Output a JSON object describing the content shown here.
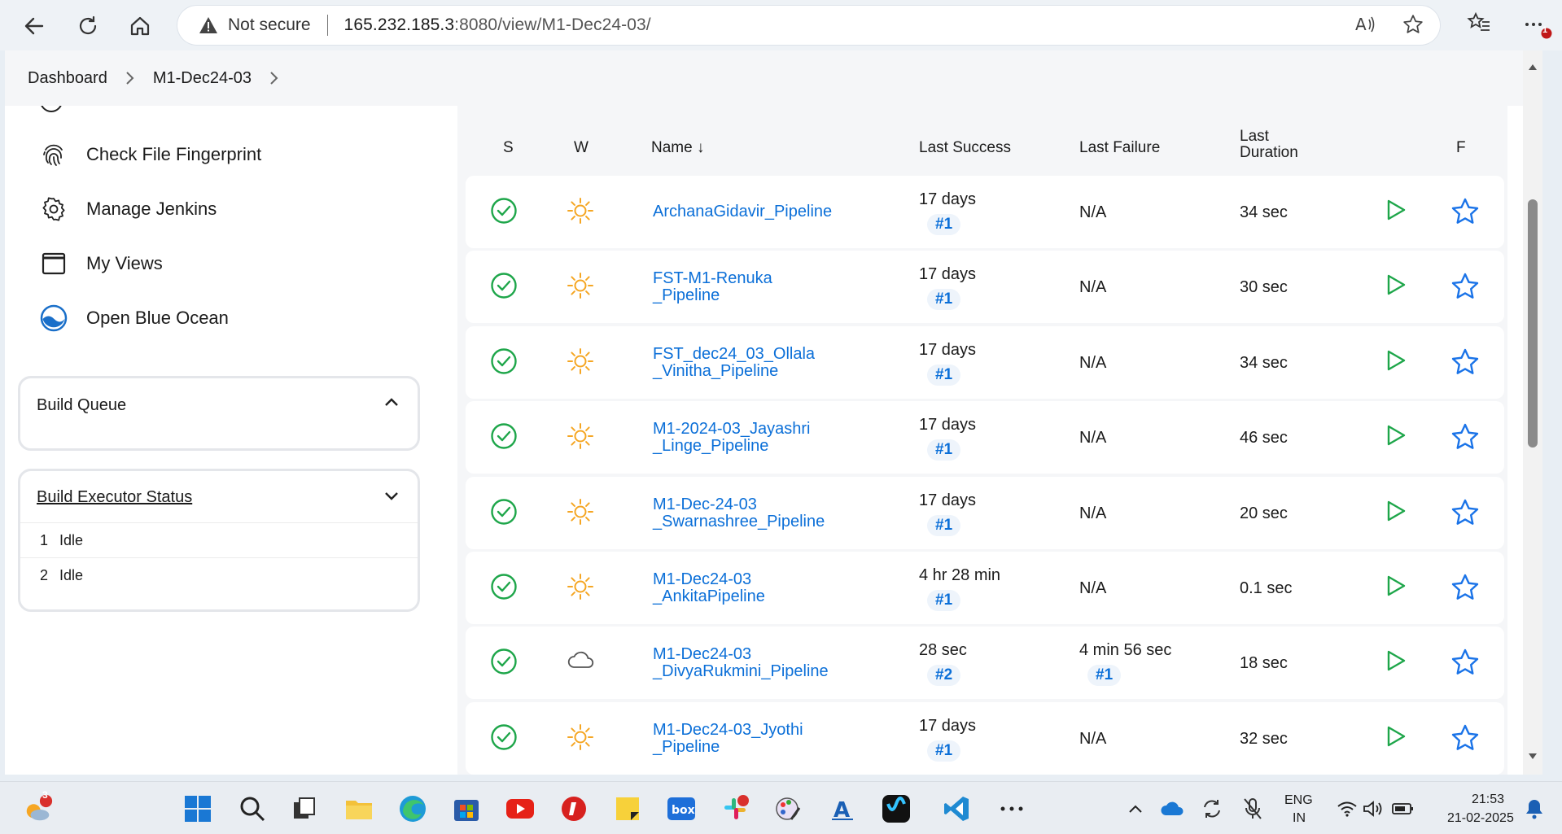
{
  "browser": {
    "security_label": "Not secure",
    "url_host": "165.232.185.3",
    "url_rest": ":8080/view/M1-Dec24-03/",
    "notification_count": "1"
  },
  "breadcrumb": [
    "Dashboard",
    "M1-Dec24-03"
  ],
  "sidebar": {
    "items": [
      {
        "label": "Check File Fingerprint",
        "icon": "fingerprint-icon"
      },
      {
        "label": "Manage Jenkins",
        "icon": "gear-icon"
      },
      {
        "label": "My Views",
        "icon": "window-icon"
      },
      {
        "label": "Open Blue Ocean",
        "icon": "blue-ocean-icon"
      }
    ],
    "build_queue": {
      "title": "Build Queue"
    },
    "executor": {
      "title": "Build Executor Status",
      "rows": [
        {
          "num": "1",
          "status": "Idle"
        },
        {
          "num": "2",
          "status": "Idle"
        }
      ]
    }
  },
  "table": {
    "headers": {
      "s": "S",
      "w": "W",
      "name": "Name ↓",
      "last_success": "Last Success",
      "last_failure": "Last Failure",
      "last_duration_1": "Last",
      "last_duration_2": "Duration",
      "f": "F"
    },
    "rows": [
      {
        "name1": "ArchanaGidavir_Pipeline",
        "name2": "",
        "ls": "17 days",
        "ls_build": "#1",
        "lf": "N/A",
        "lf_build": "",
        "dur": "34 sec",
        "weather": "sunny"
      },
      {
        "name1": "FST-M1-Renuka",
        "name2": "_Pipeline",
        "ls": "17 days",
        "ls_build": "#1",
        "lf": "N/A",
        "lf_build": "",
        "dur": "30 sec",
        "weather": "sunny"
      },
      {
        "name1": "FST_dec24_03_Ollala",
        "name2": "_Vinitha_Pipeline",
        "ls": "17 days",
        "ls_build": "#1",
        "lf": "N/A",
        "lf_build": "",
        "dur": "34 sec",
        "weather": "sunny"
      },
      {
        "name1": "M1-2024-03_Jayashri",
        "name2": "_Linge_Pipeline",
        "ls": "17 days",
        "ls_build": "#1",
        "lf": "N/A",
        "lf_build": "",
        "dur": "46 sec",
        "weather": "sunny"
      },
      {
        "name1": "M1-Dec-24-03",
        "name2": "_Swarnashree_Pipeline",
        "ls": "17 days",
        "ls_build": "#1",
        "lf": "N/A",
        "lf_build": "",
        "dur": "20 sec",
        "weather": "sunny"
      },
      {
        "name1": "M1-Dec24-03",
        "name2": "_AnkitaPipeline",
        "ls": "4 hr 28 min",
        "ls_build": "#1",
        "lf": "N/A",
        "lf_build": "",
        "dur": "0.1 sec",
        "weather": "sunny"
      },
      {
        "name1": "M1-Dec24-03",
        "name2": "_DivyaRukmini_Pipeline",
        "ls": "28 sec",
        "ls_build": "#2",
        "lf": "4 min 56 sec",
        "lf_build": "#1",
        "dur": "18 sec",
        "weather": "cloudy"
      },
      {
        "name1": "M1-Dec24-03_Jyothi",
        "name2": "_Pipeline",
        "ls": "17 days",
        "ls_build": "#1",
        "lf": "N/A",
        "lf_build": "",
        "dur": "32 sec",
        "weather": "sunny"
      }
    ]
  },
  "taskbar": {
    "weather_badge": "3",
    "lang_1": "ENG",
    "lang_2": "IN",
    "time": "21:53",
    "date": "21-02-2025"
  },
  "colors": {
    "success": "#1ea64a",
    "link": "#0b6fd8",
    "sun": "#f5a623",
    "run": "#1ea64a",
    "fav": "#1a73e8"
  }
}
